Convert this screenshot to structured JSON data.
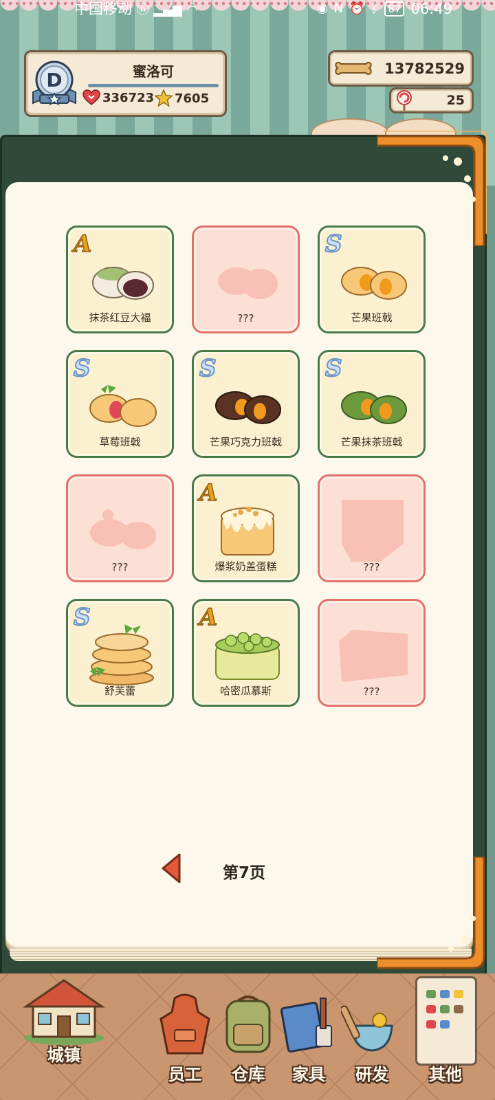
{
  "status_bar": {
    "carrier": "中国移动",
    "battery": "87",
    "time": "06:49",
    "icons": [
      "hd-icon",
      "signal-icon",
      "wifi-icon",
      "eye-icon",
      "nfc-icon",
      "alarm-icon",
      "bluetooth-icon",
      "battery-icon"
    ]
  },
  "player": {
    "rank_letter": "D",
    "name": "蜜洛可",
    "hearts": "336723",
    "stars": "7605"
  },
  "currency": {
    "bones": "13782529",
    "candy": "25"
  },
  "recipes": [
    {
      "name": "抹茶红豆大福",
      "rank": "A",
      "locked": false,
      "art": "matcha-daifuku"
    },
    {
      "name": "???",
      "rank": "",
      "locked": true,
      "art": "silhouette-daifuku"
    },
    {
      "name": "芒果班戟",
      "rank": "S",
      "locked": false,
      "art": "mango-pancake"
    },
    {
      "name": "草莓班戟",
      "rank": "S",
      "locked": false,
      "art": "strawberry-pancake"
    },
    {
      "name": "芒果巧克力班戟",
      "rank": "S",
      "locked": false,
      "art": "choco-mango-pancake"
    },
    {
      "name": "芒果抹茶班戟",
      "rank": "S",
      "locked": false,
      "art": "matcha-mango-pancake"
    },
    {
      "name": "???",
      "rank": "",
      "locked": true,
      "art": "silhouette-pancake"
    },
    {
      "name": "爆浆奶盖蛋糕",
      "rank": "A",
      "locked": false,
      "art": "cheese-cake"
    },
    {
      "name": "???",
      "rank": "",
      "locked": true,
      "art": "silhouette-cake"
    },
    {
      "name": "舒芙蕾",
      "rank": "S",
      "locked": false,
      "art": "souffle"
    },
    {
      "name": "哈密瓜慕斯",
      "rank": "A",
      "locked": false,
      "art": "melon-mousse"
    },
    {
      "name": "???",
      "rank": "",
      "locked": true,
      "art": "silhouette-slice"
    }
  ],
  "pagination": {
    "label": "第7页"
  },
  "nav": {
    "town": "城镇",
    "staff": "员工",
    "storage": "仓库",
    "furniture": "家具",
    "research": "研发",
    "other": "其他"
  },
  "colors": {
    "book_green": "#2f4a38",
    "page": "#fdf8ec",
    "card_unlocked_border": "#4a7a4a",
    "card_locked_border": "#e2716e",
    "card_locked_fill": "#fde0d5",
    "orange_trim": "#ec8f2a"
  }
}
